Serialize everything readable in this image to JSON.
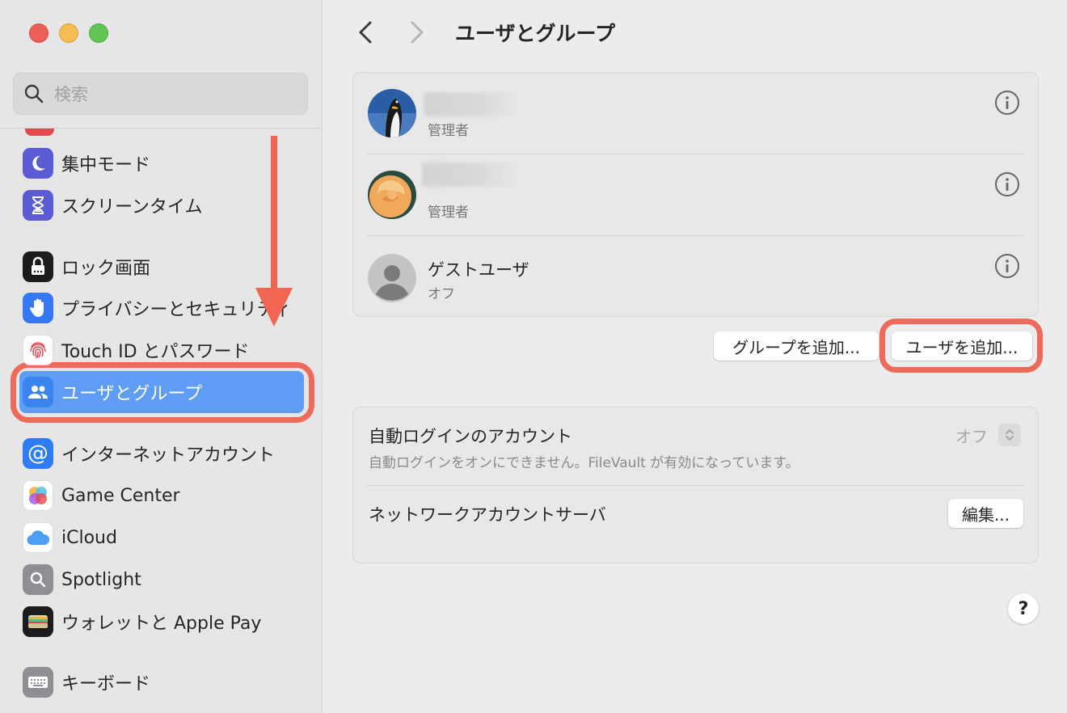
{
  "window": {
    "title": "ユーザとグループ"
  },
  "search": {
    "placeholder": "検索"
  },
  "sidebar": {
    "items": [
      {
        "label": "集中モード",
        "icon": "moon-icon"
      },
      {
        "label": "スクリーンタイム",
        "icon": "hourglass-icon"
      },
      {
        "label": "ロック画面",
        "icon": "lock-icon"
      },
      {
        "label": "プライバシーとセキュリティ",
        "icon": "hand-icon"
      },
      {
        "label": "Touch ID とパスワード",
        "icon": "fingerprint-icon"
      },
      {
        "label": "ユーザとグループ",
        "icon": "users-icon",
        "selected": true
      },
      {
        "label": "インターネットアカウント",
        "icon": "at-icon"
      },
      {
        "label": "Game Center",
        "icon": "game-center-icon"
      },
      {
        "label": "iCloud",
        "icon": "cloud-icon"
      },
      {
        "label": "Spotlight",
        "icon": "spotlight-icon"
      },
      {
        "label": "ウォレットと Apple Pay",
        "icon": "wallet-icon"
      },
      {
        "label": "キーボード",
        "icon": "keyboard-icon"
      }
    ]
  },
  "users": [
    {
      "name": "",
      "role": "管理者",
      "avatar": "penguin-avatar"
    },
    {
      "name": "",
      "role": "管理者",
      "avatar": "rose-avatar"
    },
    {
      "name": "ゲストユーザ",
      "role": "オフ",
      "avatar": "guest-avatar"
    }
  ],
  "buttons": {
    "add_group": "グループを追加...",
    "add_user": "ユーザを追加...",
    "edit": "編集...",
    "help": "?"
  },
  "login": {
    "auto_login_title": "自動ログインのアカウント",
    "auto_login_desc": "自動ログインをオンにできません。FileVault が有効になっています。",
    "auto_login_value": "オフ",
    "network_server_title": "ネットワークアカウントサーバ"
  },
  "colors": {
    "accent": "#5e9cf5",
    "annotation": "#ee6a5b"
  }
}
